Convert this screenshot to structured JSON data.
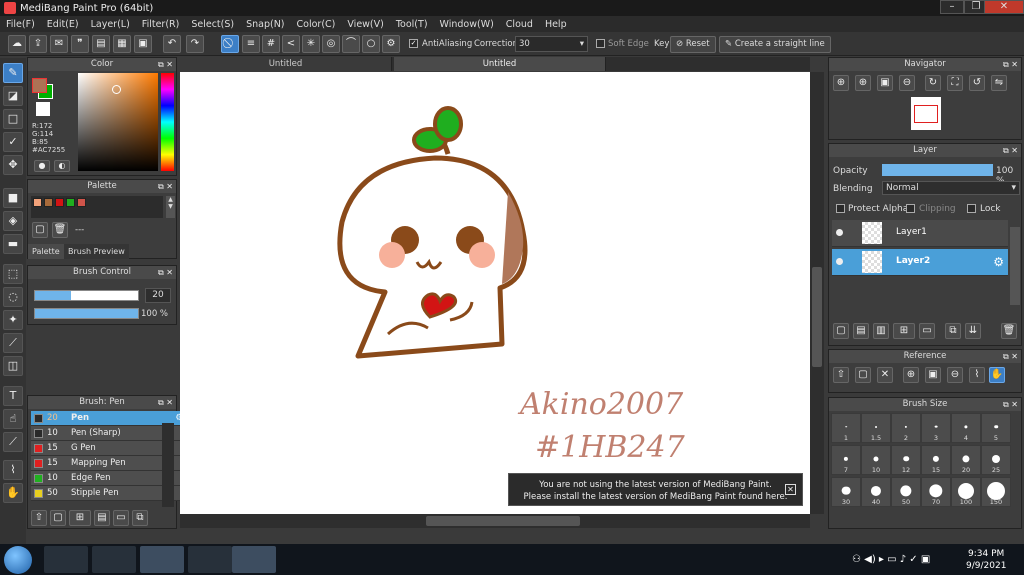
{
  "window": {
    "title": "MediBang Paint Pro (64bit)"
  },
  "menu": [
    "File(F)",
    "Edit(E)",
    "Layer(L)",
    "Filter(R)",
    "Select(S)",
    "Snap(N)",
    "Color(C)",
    "View(V)",
    "Tool(T)",
    "Window(W)",
    "Cloud",
    "Help"
  ],
  "toolbar": {
    "antialiasing_label": "AntiAliasing",
    "correction_label": "Correction",
    "correction_value": "30",
    "soft_edge_label": "Soft Edge",
    "key_label": "Key",
    "reset_label": "Reset",
    "straight_line_label": "Create a straight line"
  },
  "color_panel": {
    "title": "Color",
    "primary_color": "#AC7255",
    "secondary_color": "#00B000",
    "r": "R:172",
    "g": "G:114",
    "b": "B:85",
    "hex": "#AC7255"
  },
  "palette_panel": {
    "title": "Palette",
    "value": "---",
    "tab_palette": "Palette",
    "tab_preview": "Brush Preview",
    "colors": [
      "#f2a27a",
      "#a86a3a",
      "#d21414",
      "#1fae1f",
      "#d0544a"
    ]
  },
  "brush_control": {
    "title": "Brush Control",
    "size_value": "20",
    "opacity_value": "100 %",
    "size_fill_percent": 35,
    "opacity_fill_percent": 100
  },
  "brush_list": {
    "title": "Brush: Pen",
    "items": [
      {
        "size": "20",
        "name": "Pen",
        "color": "#2a2a2a",
        "active": true
      },
      {
        "size": "10",
        "name": "Pen (Sharp)",
        "color": "#2a2a2a"
      },
      {
        "size": "15",
        "name": "G Pen",
        "color": "#e02020"
      },
      {
        "size": "15",
        "name": "Mapping Pen",
        "color": "#e02020"
      },
      {
        "size": "10",
        "name": "Edge Pen",
        "color": "#20b020"
      },
      {
        "size": "50",
        "name": "Stipple Pen",
        "color": "#e8d020"
      }
    ]
  },
  "tabs": [
    "Untitled",
    "Untitled"
  ],
  "artwork_text": {
    "line1": "Akino2007",
    "line2": "#1HB247"
  },
  "toast": {
    "line1": "You are not using the latest version of MediBang Paint.",
    "line2": "Please install the latest version of MediBang Paint found here."
  },
  "navigator": {
    "title": "Navigator"
  },
  "layer_panel": {
    "title": "Layer",
    "opacity_label": "Opacity",
    "opacity_value": "100 %",
    "opacity_fill_percent": 100,
    "blending_label": "Blending",
    "blending_value": "Normal",
    "protect_alpha": "Protect Alpha",
    "clipping": "Clipping",
    "lock": "Lock",
    "layers": [
      {
        "name": "Layer1",
        "active": false
      },
      {
        "name": "Layer2",
        "active": true
      }
    ]
  },
  "reference": {
    "title": "Reference"
  },
  "brush_size": {
    "title": "Brush Size",
    "sizes": [
      "1",
      "1.5",
      "2",
      "3",
      "4",
      "5",
      "7",
      "10",
      "12",
      "15",
      "20",
      "25",
      "30",
      "40",
      "50",
      "70",
      "100",
      "150"
    ]
  },
  "taskbar": {
    "time": "9:34 PM",
    "date": "9/9/2021"
  }
}
